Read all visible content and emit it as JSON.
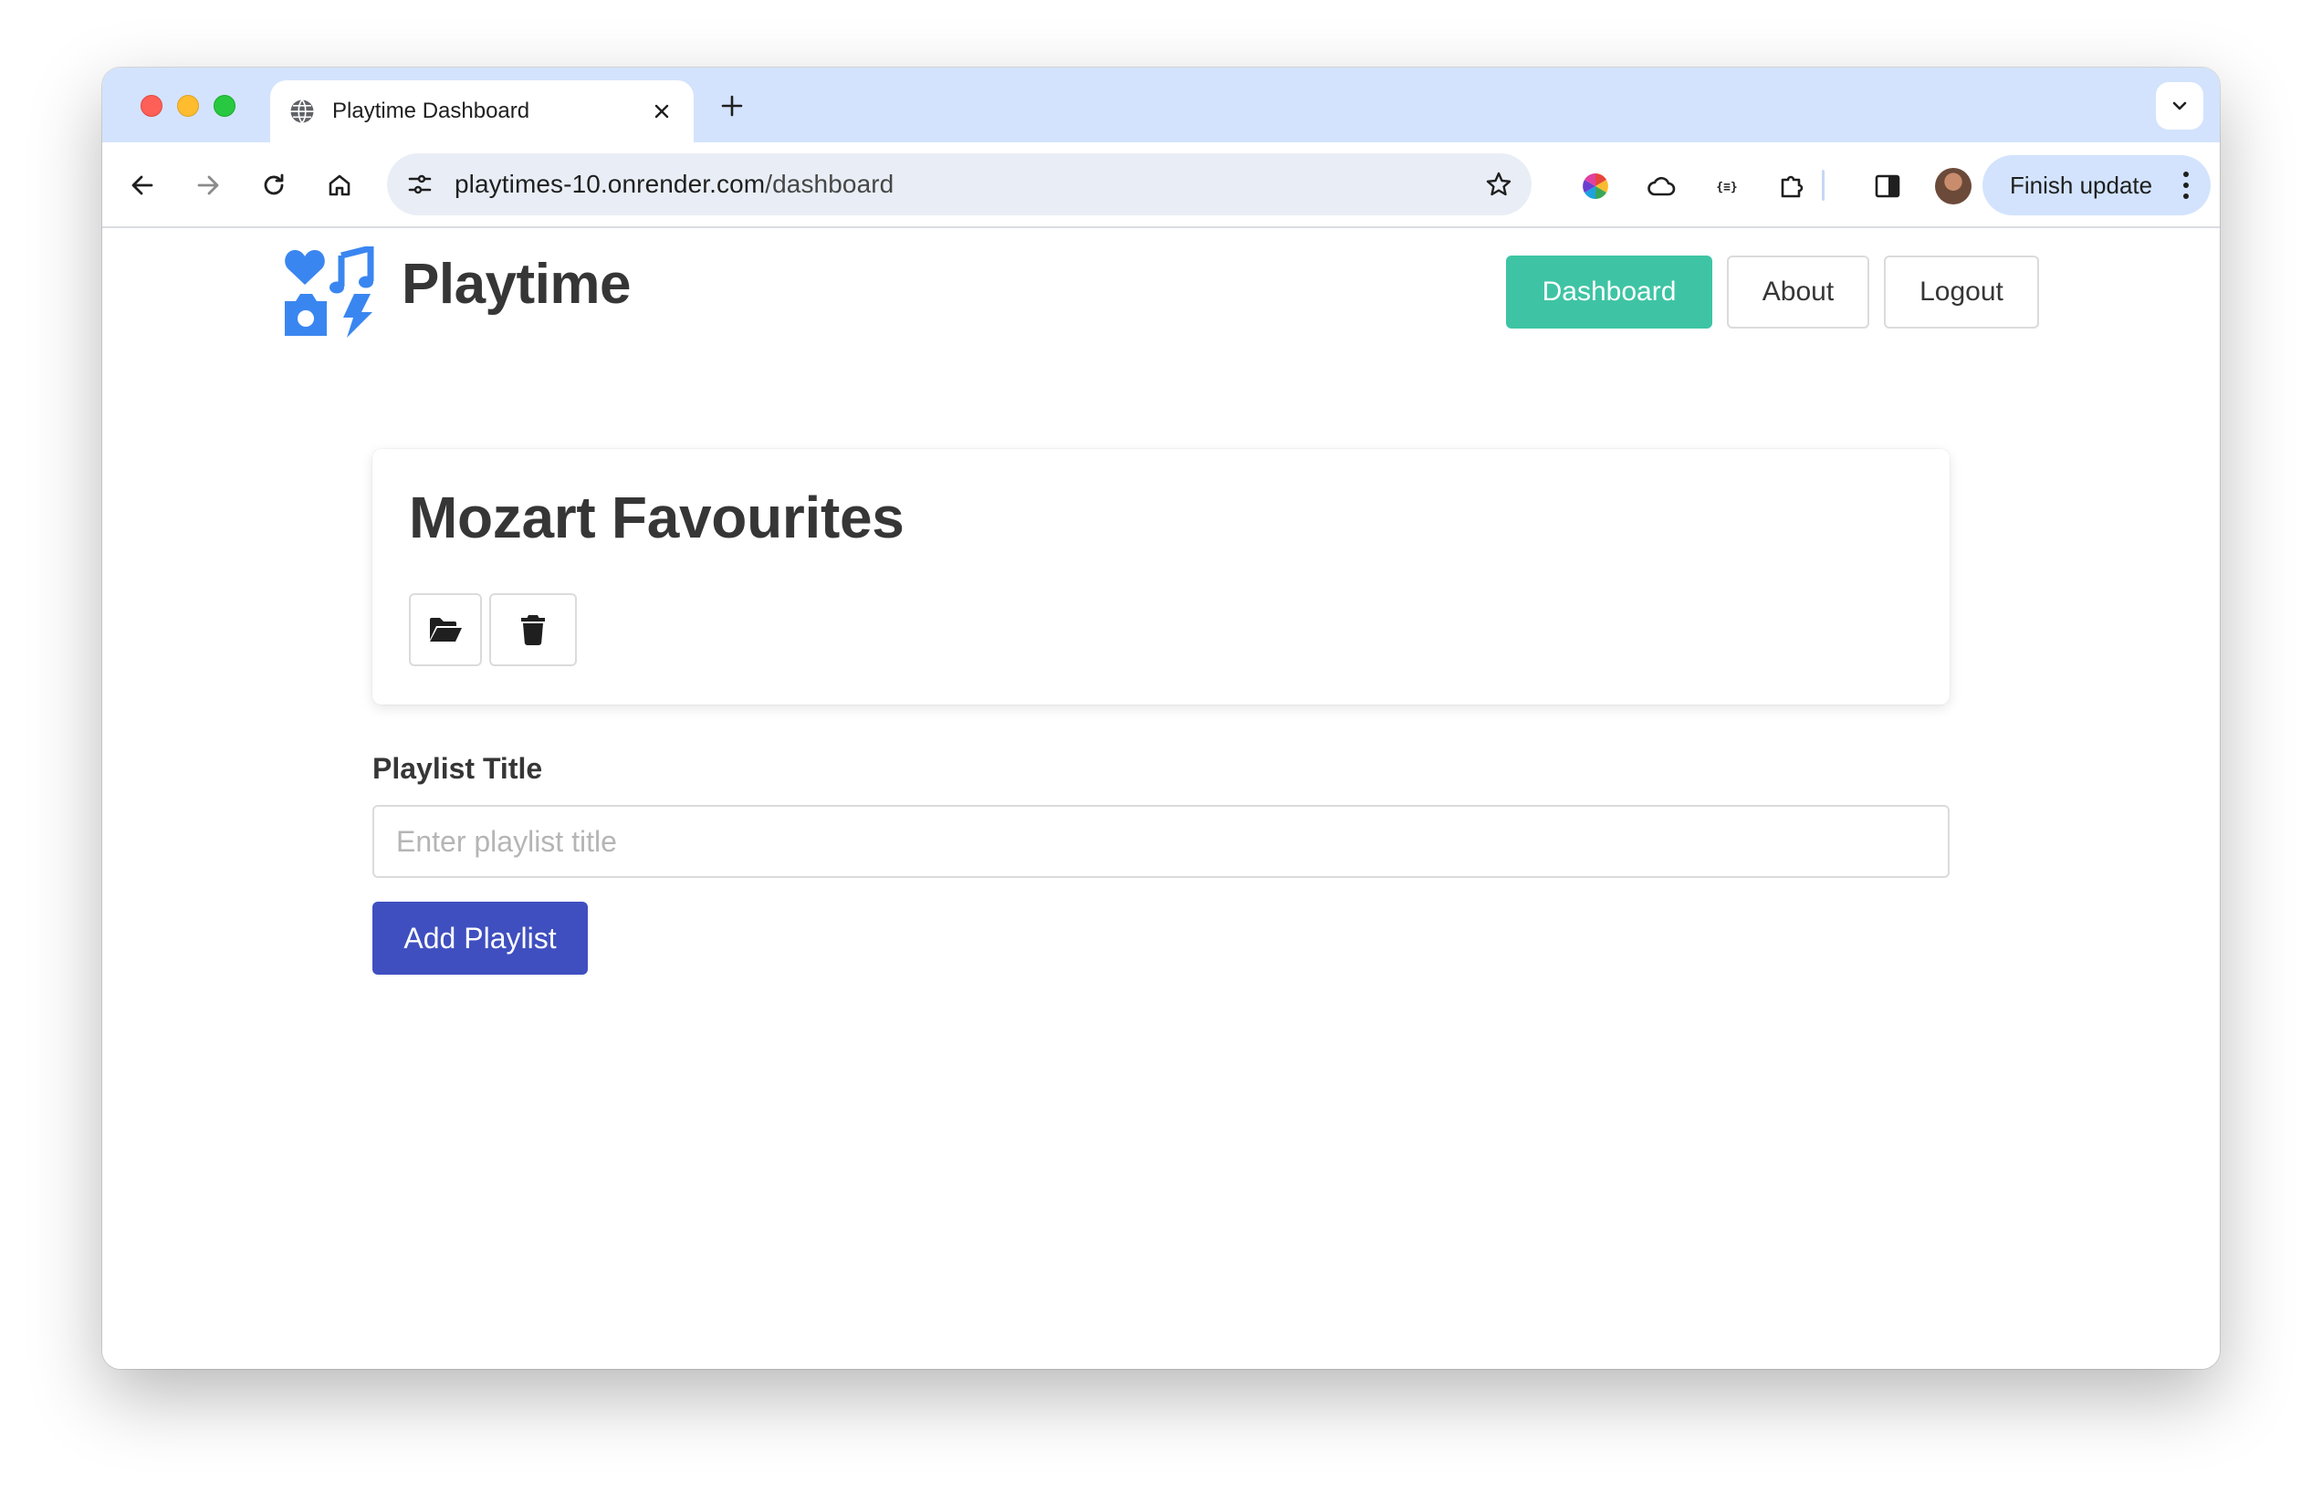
{
  "browser": {
    "tab": {
      "title": "Playtime Dashboard",
      "favicon": "globe-icon"
    },
    "url": {
      "host": "playtimes-10.onrender.com",
      "path": "/dashboard"
    },
    "finish_update_label": "Finish update"
  },
  "app": {
    "brand": "Playtime",
    "logo": "playtime-logo-icon",
    "nav": {
      "dashboard": "Dashboard",
      "about": "About",
      "logout": "Logout"
    }
  },
  "playlist_card": {
    "title": "Mozart Favourites",
    "actions": [
      "folder-open-icon",
      "trash-icon"
    ]
  },
  "form": {
    "label": "Playlist Title",
    "placeholder": "Enter playlist title",
    "value": "",
    "submit_label": "Add Playlist"
  },
  "colors": {
    "nav_active": "#3ec4a4",
    "primary_button": "#3f4fc0",
    "logo": "#3a86f0",
    "tab_strip": "#d3e3fd"
  }
}
